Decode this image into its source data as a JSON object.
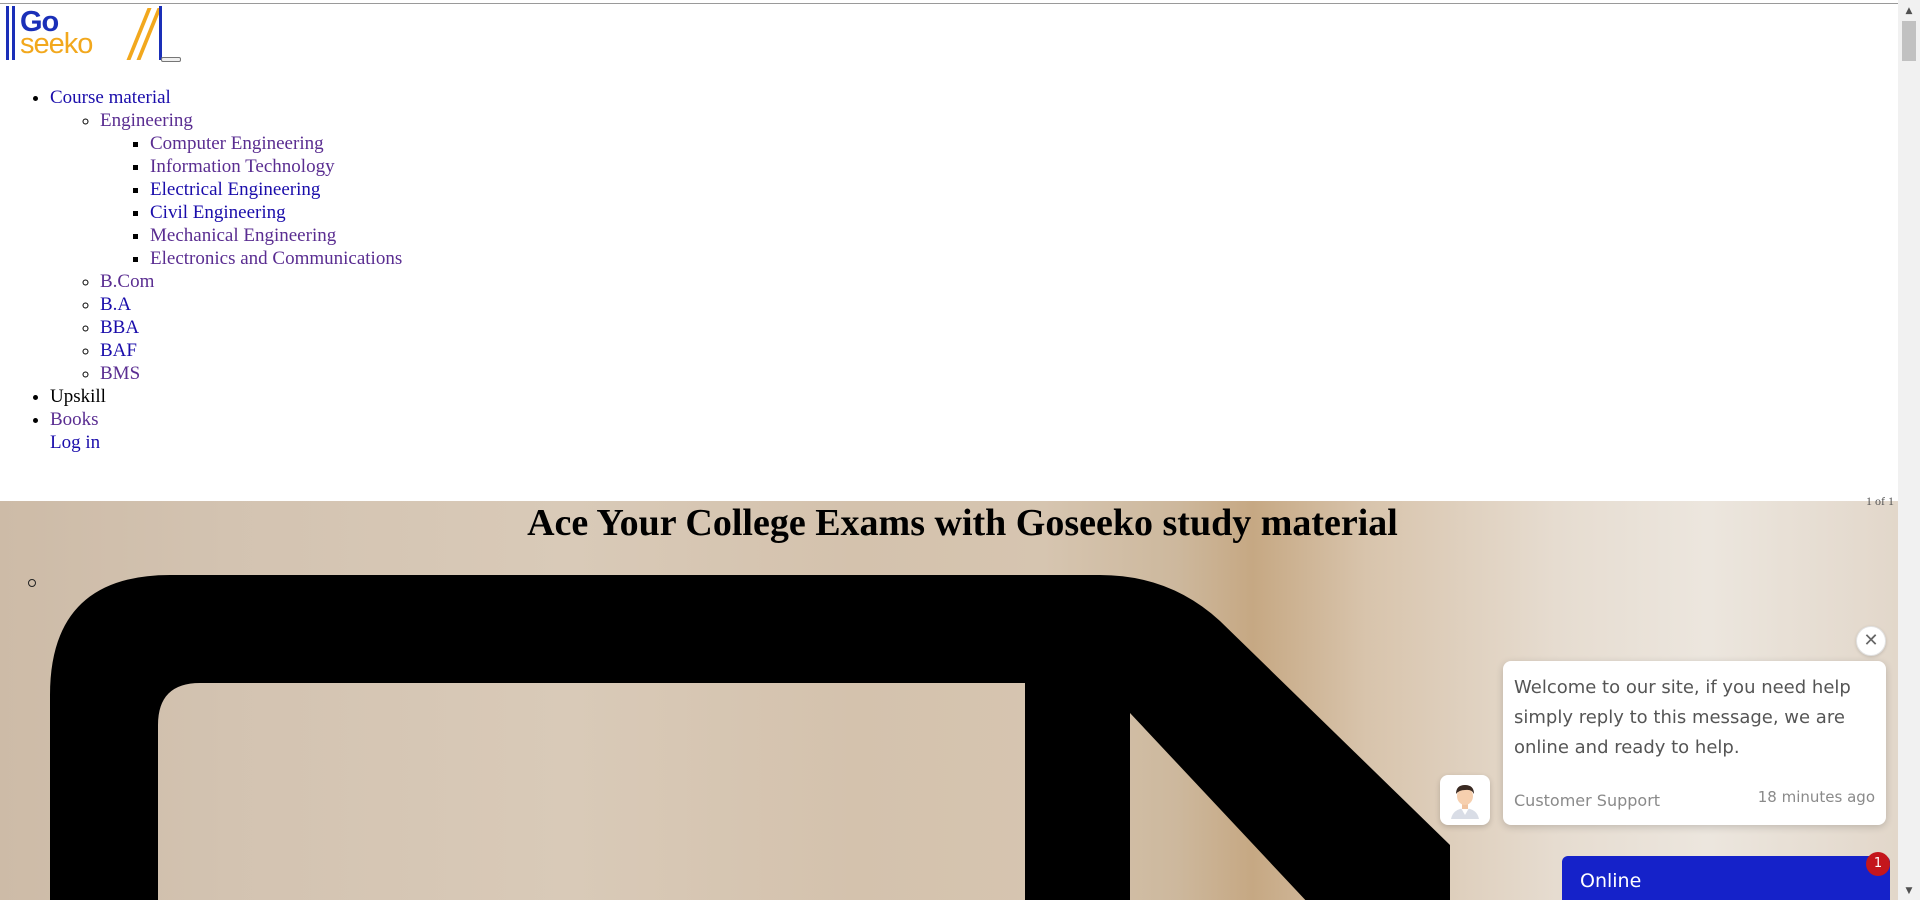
{
  "header": {
    "logo": {
      "text_top": "Go",
      "text_bottom": "seeko",
      "colors": {
        "blue": "#1a2fb8",
        "orange": "#f2a81d"
      }
    },
    "menu_toggle_icon": "hamburger-icon"
  },
  "nav": {
    "course_material": "Course material",
    "engineering": "Engineering",
    "engineering_items": [
      "Computer Engineering",
      "Information Technology",
      "Electrical Engineering",
      "Civil Engineering",
      "Mechanical Engineering",
      "Electronics and Communications"
    ],
    "other_courses": [
      "B.Com",
      "B.A",
      "BBA",
      "BAF",
      "BMS"
    ],
    "upskill": "Upskill",
    "books": "Books",
    "login": "Log in"
  },
  "hero": {
    "counter": "1 of 1",
    "title": "Ace Your College Exams with Goseeko study material",
    "icon": "document-icon"
  },
  "chat": {
    "message": "Welcome to our site, if you need help simply reply to this message, we are online and ready to help.",
    "sender": "Customer Support",
    "time": "18 minutes ago",
    "status": "Online",
    "badge": "1",
    "close_icon": "close-icon",
    "avatar_icon": "support-agent-icon",
    "colors": {
      "online_bar": "#1522c9",
      "badge": "#c4161c"
    }
  }
}
